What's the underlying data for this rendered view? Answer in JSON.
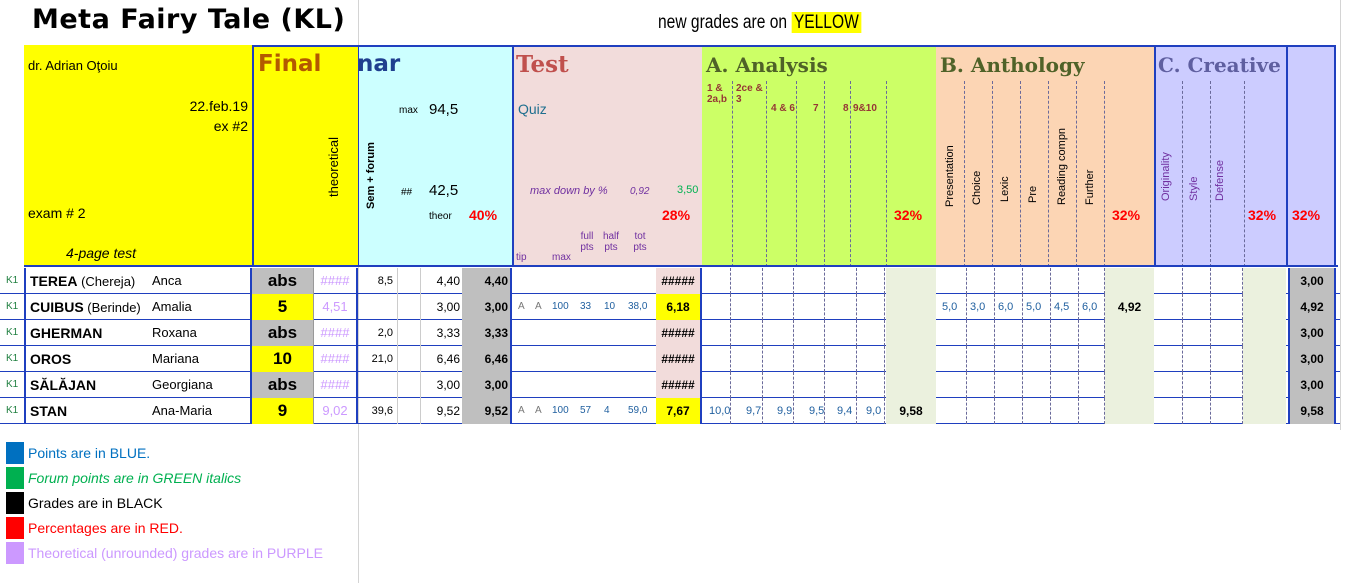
{
  "header": {
    "title": "Meta Fairy Tale (KL)",
    "new_grades_prefix": "new grades are on ",
    "new_grades_highlight": "YELLOW"
  },
  "info": {
    "teacher": "dr. Adrian Oţoiu",
    "date": "22.feb.19",
    "exam_code": "ex #2",
    "exam_label": "exam # 2",
    "test_desc": "4-page test"
  },
  "sections": {
    "final": {
      "title": "Final",
      "theoretical": "theoretical"
    },
    "seminar": {
      "title": "nar",
      "vert": "Sem + forum",
      "max_label": "max",
      "max_value": "94,5",
      "hash_label": "##",
      "hash_value": "42,5",
      "theor_label": "theor",
      "percent": "40%"
    },
    "test": {
      "title": "Test",
      "quiz": "Quiz",
      "max_down": "max down by %",
      "max_down_val1": "0,92",
      "max_down_val2": "3,50",
      "percent": "28%",
      "sub": [
        "tip",
        "max",
        "full pts",
        "half pts",
        "tot pts"
      ]
    },
    "analysis": {
      "title": "A. Analysis",
      "cols": [
        "1 & 2a,b",
        "2ce & 3",
        "4 & 6",
        "7",
        "8",
        "9&10"
      ],
      "percent": "32%"
    },
    "anthology": {
      "title": "B. Anthology",
      "cols": [
        "Presentation",
        "Choice",
        "Lexic",
        "Pre",
        "Reading compn",
        "Further"
      ],
      "percent": "32%"
    },
    "creative": {
      "title": "C. Creative",
      "cols": [
        "Originality",
        "Style",
        "Defense"
      ],
      "percent": "32%",
      "percent2": "32%"
    }
  },
  "rows": [
    {
      "k": "K1",
      "last": "TEREA",
      "paren": "(Chereja)",
      "first": "Anca",
      "grade": "abs",
      "theor": "####",
      "s1": "8,5",
      "s2": "4,40",
      "s3": "4,40",
      "test": [
        "",
        "",
        "",
        "",
        "",
        ""
      ],
      "ttot": "#####",
      "a": [
        "",
        "",
        "",
        "",
        "",
        ""
      ],
      "atot": "",
      "b": [
        "",
        "",
        "",
        "",
        "",
        ""
      ],
      "btot": "",
      "final": "3,00"
    },
    {
      "k": "K1",
      "last": "CUIBUS",
      "paren": "(Berinde)",
      "first": "Amalia",
      "grade": "5",
      "theor": "4,51",
      "s1": "",
      "s2": "3,00",
      "s3": "3,00",
      "test": [
        "A",
        "A",
        "100",
        "33",
        "10",
        "38,0"
      ],
      "ttot": "6,18",
      "a": [
        "",
        "",
        "",
        "",
        "",
        ""
      ],
      "atot": "",
      "b": [
        "5,0",
        "3,0",
        "6,0",
        "5,0",
        "4,5",
        "6,0"
      ],
      "btot": "4,92",
      "final": "4,92"
    },
    {
      "k": "K1",
      "last": "GHERMAN",
      "paren": "",
      "first": "Roxana",
      "grade": "abs",
      "theor": "####",
      "s1": "2,0",
      "s2": "3,33",
      "s3": "3,33",
      "test": [
        "",
        "",
        "",
        "",
        "",
        ""
      ],
      "ttot": "#####",
      "a": [
        "",
        "",
        "",
        "",
        "",
        ""
      ],
      "atot": "",
      "b": [
        "",
        "",
        "",
        "",
        "",
        ""
      ],
      "btot": "",
      "final": "3,00"
    },
    {
      "k": "K1",
      "last": "OROS",
      "paren": "",
      "first": "Mariana",
      "grade": "10",
      "theor": "####",
      "s1": "21,0",
      "s2": "6,46",
      "s3": "6,46",
      "test": [
        "",
        "",
        "",
        "",
        "",
        ""
      ],
      "ttot": "#####",
      "a": [
        "",
        "",
        "",
        "",
        "",
        ""
      ],
      "atot": "",
      "b": [
        "",
        "",
        "",
        "",
        "",
        ""
      ],
      "btot": "",
      "final": "3,00"
    },
    {
      "k": "K1",
      "last": "SĂLĂJAN",
      "paren": "",
      "first": "Georgiana",
      "grade": "abs",
      "theor": "####",
      "s1": "",
      "s2": "3,00",
      "s3": "3,00",
      "test": [
        "",
        "",
        "",
        "",
        "",
        ""
      ],
      "ttot": "#####",
      "a": [
        "",
        "",
        "",
        "",
        "",
        ""
      ],
      "atot": "",
      "b": [
        "",
        "",
        "",
        "",
        "",
        ""
      ],
      "btot": "",
      "final": "3,00"
    },
    {
      "k": "K1",
      "last": "STAN",
      "paren": "",
      "first": "Ana-Maria",
      "grade": "9",
      "theor": "9,02",
      "s1": "39,6",
      "s2": "9,52",
      "s3": "9,52",
      "test": [
        "A",
        "A",
        "100",
        "57",
        "4",
        "59,0"
      ],
      "ttot": "7,67",
      "a": [
        "10,0",
        "9,7",
        "9,9",
        "9,5",
        "9,4",
        "9,0"
      ],
      "atot": "9,58",
      "b": [
        "",
        "",
        "",
        "",
        "",
        ""
      ],
      "btot": "",
      "final": "9,58"
    }
  ],
  "legend": [
    {
      "text": "Points are in BLUE.",
      "color": "#0070c0",
      "text_color": "#0070c0",
      "italic": false
    },
    {
      "text": "Forum points are in GREEN italics",
      "color": "#00b050",
      "text_color": "#00b050",
      "italic": true
    },
    {
      "text": "Grades are in BLACK",
      "color": "#000000",
      "text_color": "#000000",
      "italic": false
    },
    {
      "text": "Percentages are in RED.",
      "color": "#ff0000",
      "text_color": "#ff0000",
      "italic": false
    },
    {
      "text": "Theoretical (unrounded) grades are in PURPLE",
      "color": "#cc99ff",
      "text_color": "#cc99ff",
      "italic": false
    }
  ],
  "colors": {
    "final_bg": "#ffff00",
    "seminar_bg": "#ccffff",
    "test_bg": "#f2dcdb",
    "analysis_bg": "#ccff66",
    "anthology_bg": "#fcd5b4",
    "creative_bg": "#ccccff",
    "border_blue": "#1f3fbf"
  }
}
